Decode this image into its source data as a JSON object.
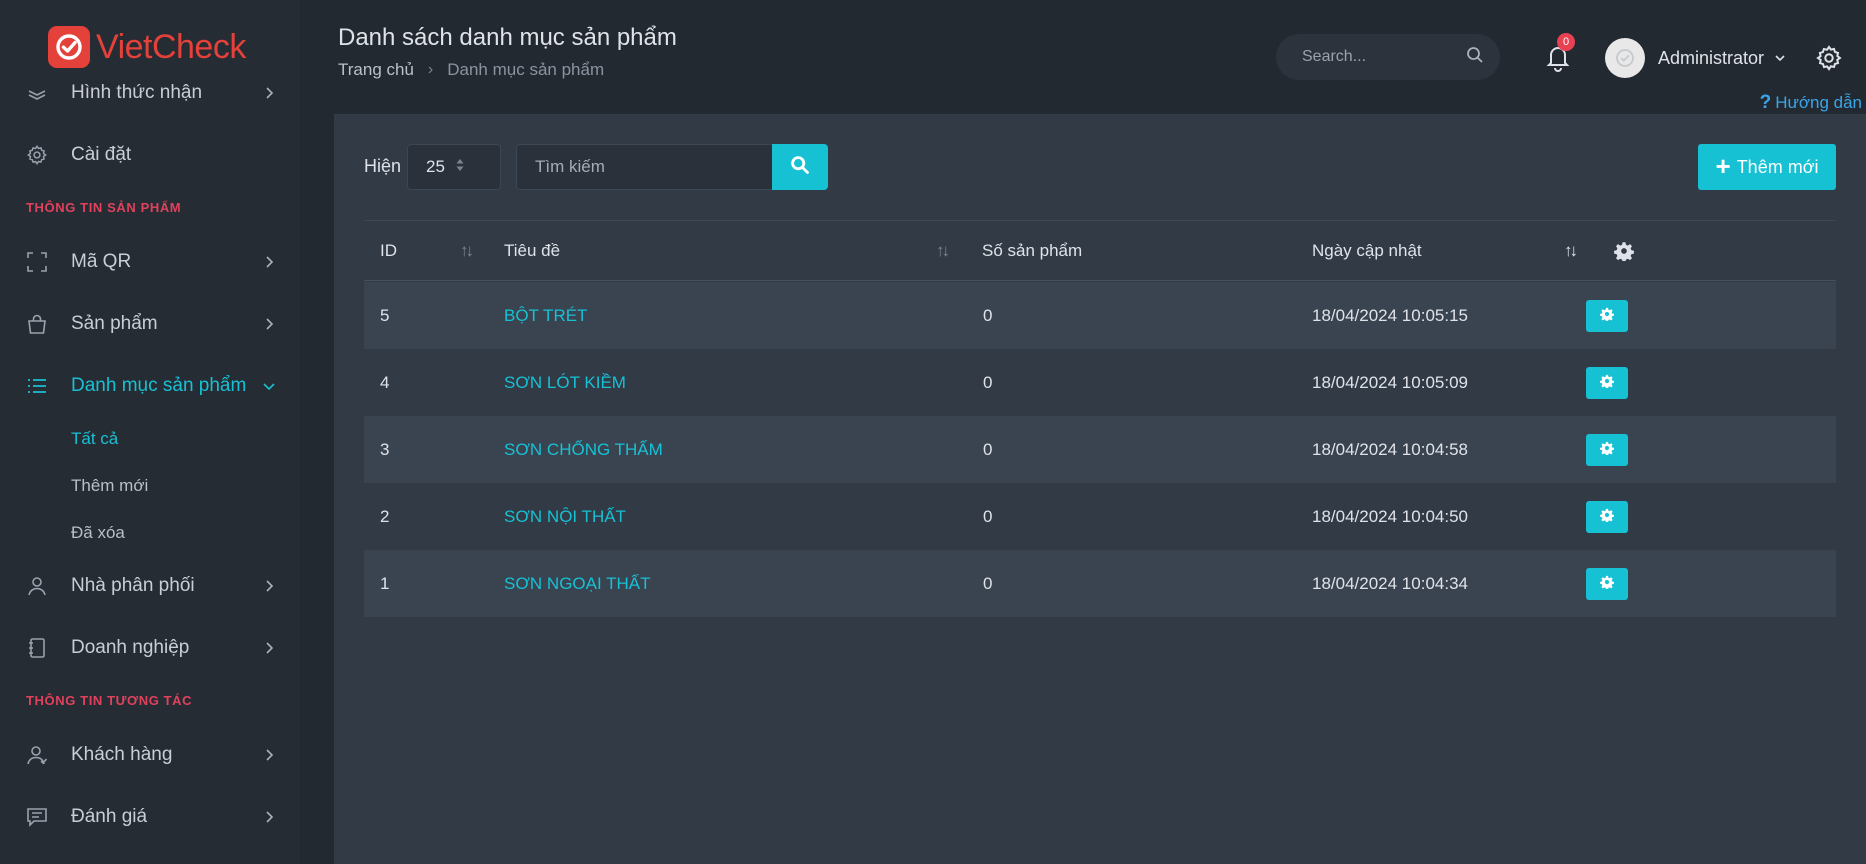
{
  "app": {
    "brand": "VietCheck"
  },
  "sidebar": {
    "items": [
      {
        "label": "Hình thức nhận",
        "icon": "layers-icon"
      },
      {
        "label": "Cài đặt",
        "icon": "gear-icon"
      },
      {
        "label": "Mã QR",
        "icon": "qr-scan-icon"
      },
      {
        "label": "Sản phẩm",
        "icon": "shopping-bag-icon"
      },
      {
        "label": "Danh mục sản phẩm",
        "icon": "list-icon"
      },
      {
        "label": "Nhà phân phối",
        "icon": "user-icon"
      },
      {
        "label": "Doanh nghiệp",
        "icon": "notebook-icon"
      },
      {
        "label": "Khách hàng",
        "icon": "users-icon"
      },
      {
        "label": "Đánh giá",
        "icon": "chat-icon"
      }
    ],
    "sections": [
      "THÔNG TIN SẢN PHẨM",
      "THÔNG TIN TƯƠNG TÁC"
    ],
    "submenu": [
      "Tất cả",
      "Thêm mới",
      "Đã xóa"
    ]
  },
  "header": {
    "title": "Danh sách danh mục sản phẩm",
    "breadcrumb": {
      "home": "Trang chủ",
      "current": "Danh mục sản phẩm"
    },
    "search_placeholder": "Search...",
    "notification_count": "0",
    "user_name": "Administrator",
    "help": "Hướng dẫn",
    "help_icon": "?"
  },
  "toolbar": {
    "show_label": "Hiện",
    "page_size": "25",
    "search_placeholder": "Tìm kiếm",
    "add_label": "Thêm mới",
    "add_icon": "+"
  },
  "table": {
    "columns": [
      "ID",
      "Tiêu đề",
      "Số sản phẩm",
      "Ngày cập nhật"
    ],
    "sort_glyph": "↑↓",
    "rows": [
      {
        "id": "5",
        "title": "BỘT TRÉT",
        "count": "0",
        "updated": "18/04/2024 10:05:15"
      },
      {
        "id": "4",
        "title": "SƠN LÓT KIỀM",
        "count": "0",
        "updated": "18/04/2024 10:05:09"
      },
      {
        "id": "3",
        "title": "SƠN CHỐNG THẤM",
        "count": "0",
        "updated": "18/04/2024 10:04:58"
      },
      {
        "id": "2",
        "title": "SƠN NỘI THẤT",
        "count": "0",
        "updated": "18/04/2024 10:04:50"
      },
      {
        "id": "1",
        "title": "SƠN NGOẠI THẤT",
        "count": "0",
        "updated": "18/04/2024 10:04:34"
      }
    ]
  },
  "colors": {
    "accent": "#17c1d4",
    "section": "#e0415c",
    "brand": "#e4413a",
    "badge": "#e84151"
  }
}
